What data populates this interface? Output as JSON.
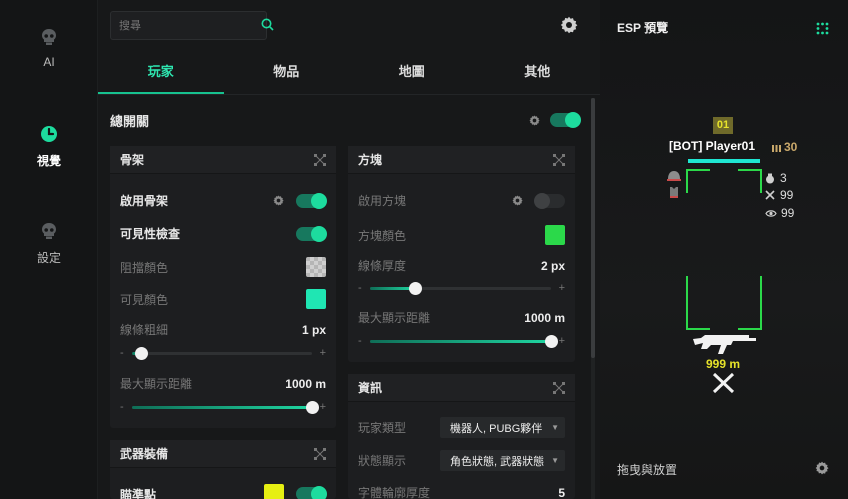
{
  "nav": {
    "items": [
      {
        "label": "AI",
        "icon": "skull-icon",
        "active": false
      },
      {
        "label": "視覺",
        "icon": "eye-clock-icon",
        "active": true
      },
      {
        "label": "設定",
        "icon": "skull-icon",
        "active": false
      }
    ]
  },
  "search": {
    "placeholder": "搜尋"
  },
  "tabs": [
    {
      "label": "玩家",
      "active": true
    },
    {
      "label": "物品",
      "active": false
    },
    {
      "label": "地圖",
      "active": false
    },
    {
      "label": "其他",
      "active": false
    }
  ],
  "master": {
    "label": "總開關",
    "enabled": true
  },
  "skeleton": {
    "title": "骨架",
    "enable_label": "啟用骨架",
    "visibility_label": "可見性檢查",
    "blocked_color_label": "阻擋顏色",
    "visible_color_label": "可見顏色",
    "line_width_label": "線條粗細",
    "line_width_value": "1 px",
    "line_width_level": 0.05,
    "max_dist_label": "最大顯示距離",
    "max_dist_value": "1000 m",
    "max_dist_level": 1.0,
    "minus": "-",
    "plus": "+"
  },
  "box": {
    "title": "方塊",
    "enable_label": "啟用方塊",
    "color_label": "方塊顏色",
    "thickness_label": "線條厚度",
    "thickness_value": "2 px",
    "thickness_level": 0.25,
    "max_dist_label": "最大顯示距離",
    "max_dist_value": "1000 m",
    "max_dist_level": 1.0,
    "minus": "-",
    "plus": "+"
  },
  "info": {
    "title": "資訊",
    "player_type_label": "玩家類型",
    "player_type_value": "機器人, PUBG夥伴",
    "status_label": "狀態顯示",
    "status_value": "角色狀態, 武器狀態",
    "font_outline_label": "字體輪廓厚度",
    "font_outline_value": "5"
  },
  "weapon": {
    "title": "武器裝備",
    "crosshair_label": "瞄準點"
  },
  "preview": {
    "title": "ESP 預覽",
    "team_badge": "01",
    "player_name": "[BOT] Player01",
    "ammo": "30",
    "kills": "3",
    "stat2": "99",
    "stat3": "99",
    "distance": "999 m",
    "footer": "拖曳與放置"
  },
  "colors": {
    "accent": "#1ddc9e",
    "box_green": "#2bd94a",
    "teal_swatch": "#1fe6b3",
    "yellow_swatch": "#e6ef12",
    "distance_yellow": "#e6e22a"
  }
}
